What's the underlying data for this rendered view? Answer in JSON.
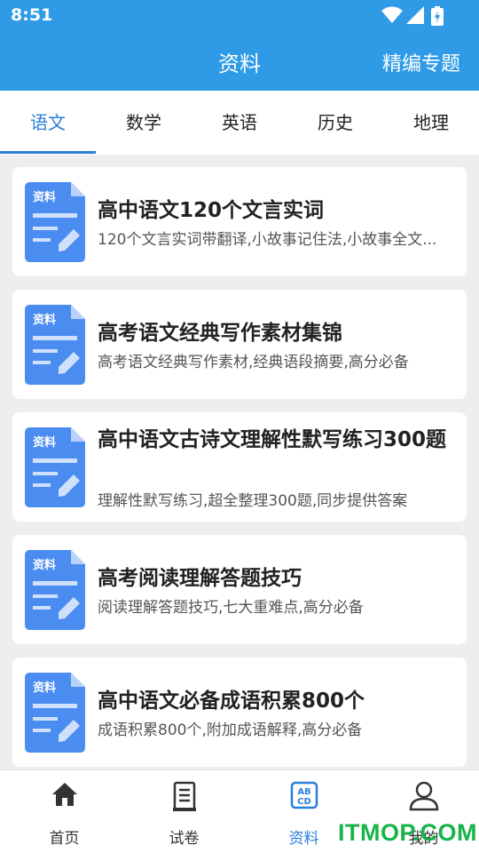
{
  "status_bar": {
    "time": "8:51"
  },
  "header": {
    "title": "资料",
    "action": "精编专题"
  },
  "tabs": [
    {
      "label": "语文",
      "active": true
    },
    {
      "label": "数学",
      "active": false
    },
    {
      "label": "英语",
      "active": false
    },
    {
      "label": "历史",
      "active": false
    },
    {
      "label": "地理",
      "active": false
    }
  ],
  "doc_icon": {
    "badge": "资料",
    "color": "#4a8cf0"
  },
  "items": [
    {
      "title": "高中语文120个文言实词",
      "desc": "120个文言实词带翻译,小故事记住法,小故事全文..."
    },
    {
      "title": "高考语文经典写作素材集锦",
      "desc": "高考语文经典写作素材,经典语段摘要,高分必备"
    },
    {
      "title": "高中语文古诗文理解性默写练习300题",
      "desc": "理解性默写练习,超全整理300题,同步提供答案"
    },
    {
      "title": "高考阅读理解答题技巧",
      "desc": "阅读理解答题技巧,七大重难点,高分必备"
    },
    {
      "title": "高中语文必备成语积累800个",
      "desc": "成语积累800个,附加成语解释,高分必备"
    }
  ],
  "bottom_nav": [
    {
      "label": "首页",
      "icon": "home-icon",
      "active": false
    },
    {
      "label": "试卷",
      "icon": "paper-icon",
      "active": false
    },
    {
      "label": "资料",
      "icon": "abcd-icon",
      "active": true
    },
    {
      "label": "我的",
      "icon": "user-icon",
      "active": false
    }
  ],
  "watermark": "ITMOP.COM",
  "colors": {
    "primary": "#2f9be6",
    "accent": "#2a7fd8",
    "background": "#eeeeee"
  }
}
